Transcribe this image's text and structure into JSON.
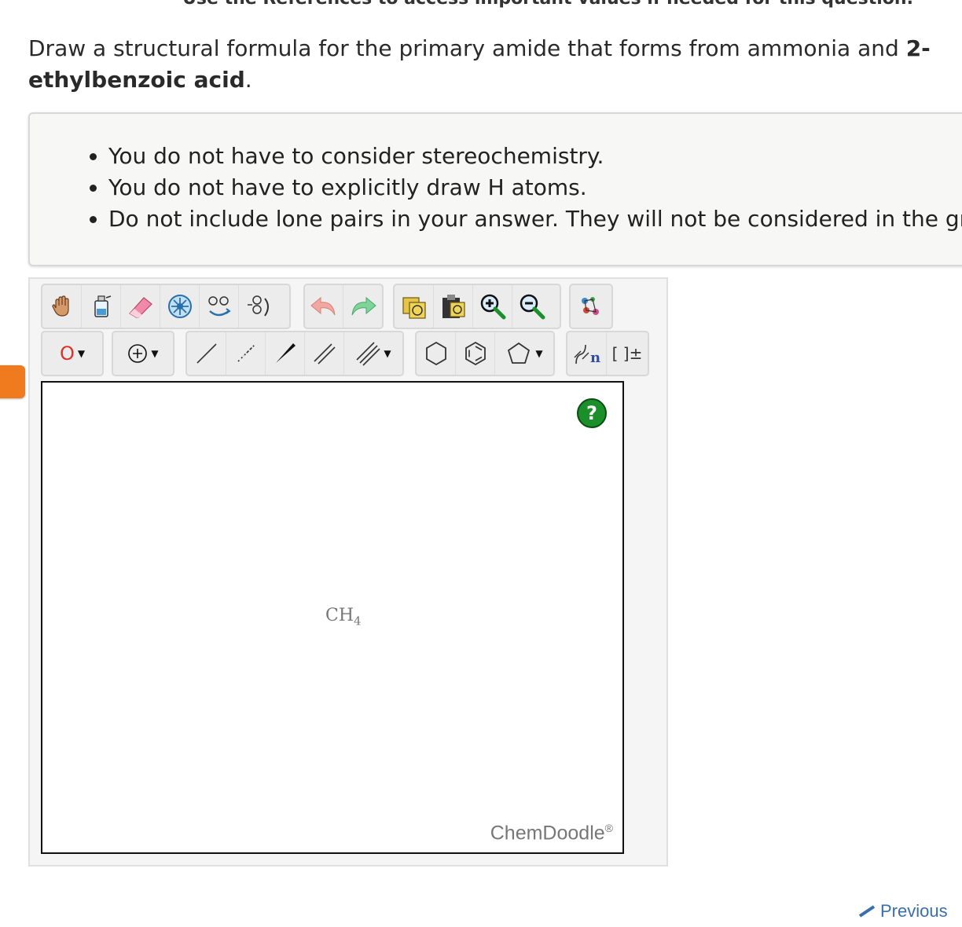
{
  "banner": "Use the References to access important values if needed for this question.",
  "question": {
    "text_before": "Draw a structural formula for the primary amide that forms from ammonia and ",
    "compound": "2-ethylbenzoic acid",
    "text_after": "."
  },
  "hints": [
    "You do not have to consider stereochemistry.",
    "You do not have to explicitly draw H atoms.",
    "Do not include lone pairs in your answer. They will not be considered in the gr"
  ],
  "toolbar": {
    "element_label": "O",
    "bracket_label": "[ ]±",
    "sgroup_label": "n"
  },
  "canvas": {
    "molecule_main": "CH",
    "molecule_sub": "4",
    "help_label": "?",
    "brand": "ChemDoodle",
    "brand_mark": "®"
  },
  "nav": {
    "previous_label": "Previous"
  }
}
